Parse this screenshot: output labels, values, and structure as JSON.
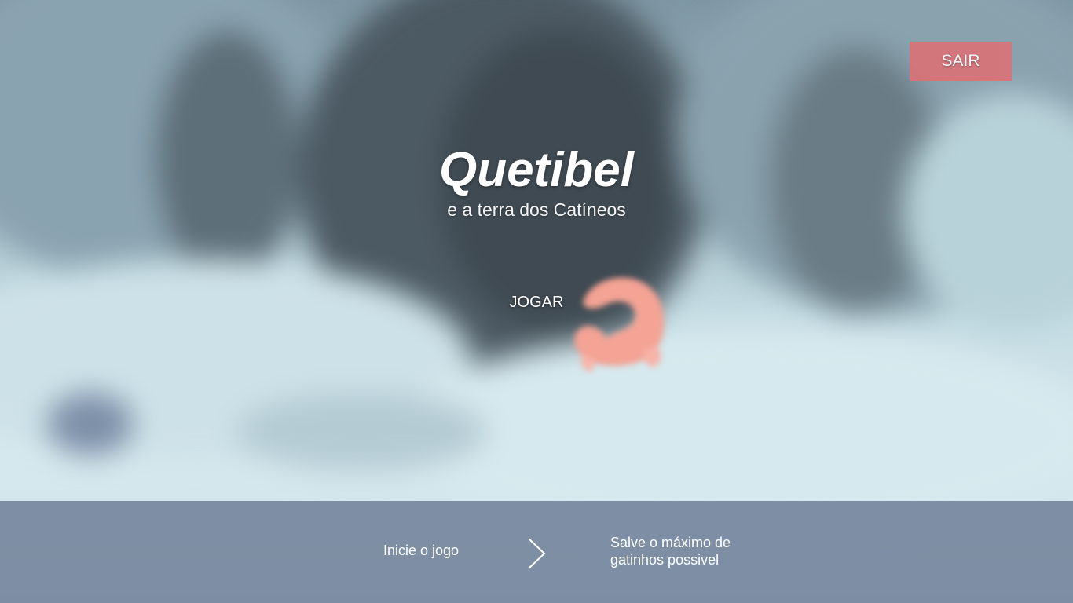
{
  "header": {
    "exit_label": "SAIR"
  },
  "title": {
    "main": "Quetibel",
    "subtitle": "e a terra dos Catíneos"
  },
  "menu": {
    "play_label": "JOGAR"
  },
  "instructions": {
    "step_1": "Inicie o jogo",
    "step_2": "Salve o máximo de gatinhos possivel",
    "arrow_icon": "chevron-right-icon"
  },
  "colors": {
    "exit_button": "#d97378",
    "mascot": "#f4a394",
    "info_bar": "#708098"
  },
  "icons": {
    "mascot": "cat-curled-icon"
  }
}
